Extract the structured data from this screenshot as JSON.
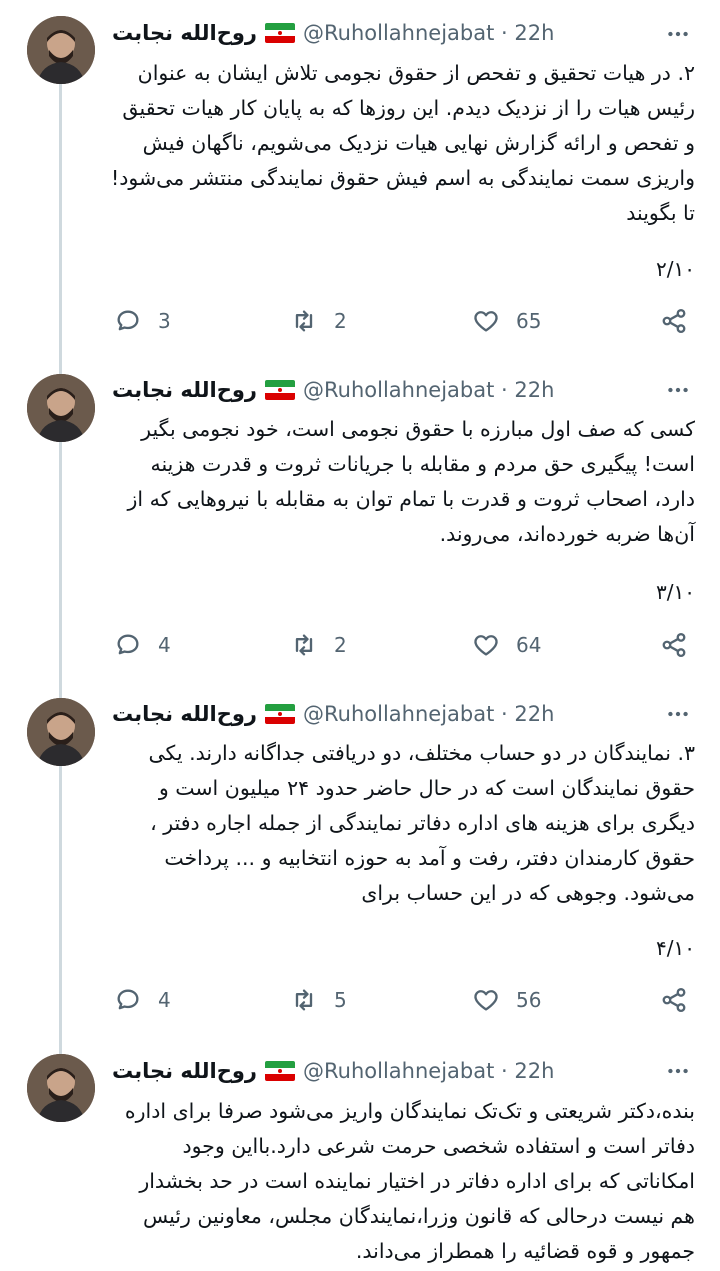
{
  "tweets": [
    {
      "author": "روح‌الله نجابت",
      "handle_time": "@Ruhollahnejabat · 22h",
      "text": "۲. در هیات تحقیق و تفحص از حقوق نجومی تلاش ایشان به عنوان رئیس هیات را از نزدیک دیدم. این روزها که به پایان کار هیات تحقیق و تفحص و ارائه گزارش نهایی هیات نزدیک می‌شویم، ناگهان فیش واریزی سمت نمایندگی به اسم فیش حقوق نمایندگی منتشر می‌شود! تا بگویند",
      "counter": "۲/۱۰",
      "replies": "3",
      "retweets": "2",
      "likes": "65"
    },
    {
      "author": "روح‌الله نجابت",
      "handle_time": "@Ruhollahnejabat · 22h",
      "text": "کسی که صف اول مبارزه با حقوق نجومی است، خود نجومی بگیر است! پیگیری حق مردم و مقابله با جریانات ثروت و قدرت هزینه دارد، اصحاب ثروت و قدرت با تمام توان به مقابله با نیروهایی که از آن‌ها ضربه خورده‌اند، می‌روند.",
      "counter": "۳/۱۰",
      "replies": "4",
      "retweets": "2",
      "likes": "64"
    },
    {
      "author": "روح‌الله نجابت",
      "handle_time": "@Ruhollahnejabat · 22h",
      "text": "۳. نمایندگان در دو حساب مختلف، دو دریافتی جداگانه دارند. یکی حقوق نمایندگان است که در حال حاضر حدود ۲۴ میلیون است و دیگری برای هزینه های اداره دفاتر نمایندگی از جمله اجاره دفتر ، حقوق کارمندان دفتر، رفت و آمد به حوزه انتخابیه و ... پرداخت می‌شود. وجوهی که در این حساب برای",
      "counter": "۴/۱۰",
      "replies": "4",
      "retweets": "5",
      "likes": "56"
    },
    {
      "author": "روح‌الله نجابت",
      "handle_time": "@Ruhollahnejabat · 22h",
      "text": "بنده،دکتر شریعتی و تک‌تک نمایندگان واریز می‌شود صرفا برای اداره دفاتر است و استفاده شخصی حرمت شرعی دارد.بااین وجود امکاناتی که برای اداره دفاتر در اختیار نماینده است در حد بخشدار هم نیست درحالی که قانون وزرا،نمایندگان مجلس، معاونین رئیس جمهور و قوه قضائیه را همطراز می‌داند."
    }
  ],
  "icons": {
    "reply": "reply-icon",
    "retweet": "retweet-icon",
    "like": "heart-icon",
    "share": "share-icon",
    "more": "more-icon",
    "flag": "iran-flag-icon"
  },
  "colors": {
    "secondary_text": "#536471",
    "thread_line": "#cfd9de"
  }
}
